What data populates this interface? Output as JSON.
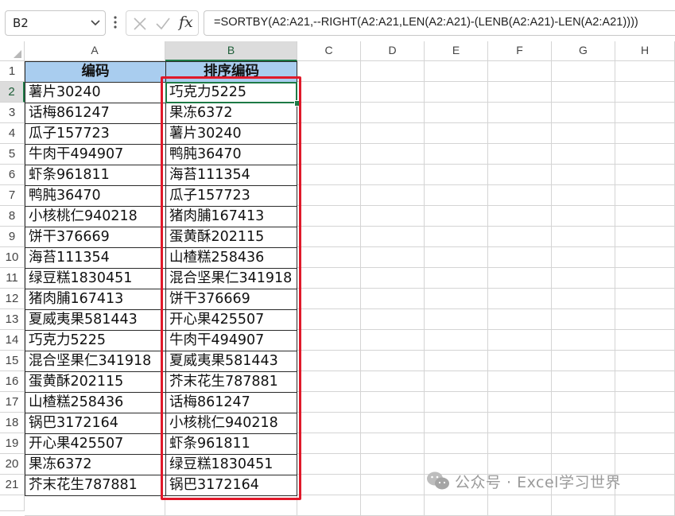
{
  "formula_bar": {
    "name_box": "B2",
    "fx_label": "fx",
    "formula": "=SORTBY(A2:A21,--RIGHT(A2:A21,LEN(A2:A21)-(LENB(A2:A21)-LEN(A2:A21))))"
  },
  "sheet": {
    "columns": [
      "A",
      "B",
      "C",
      "D",
      "E",
      "F",
      "G",
      "H"
    ],
    "rows": [
      "1",
      "2",
      "3",
      "4",
      "5",
      "6",
      "7",
      "8",
      "9",
      "10",
      "11",
      "12",
      "13",
      "14",
      "15",
      "16",
      "17",
      "18",
      "19",
      "20",
      "21"
    ],
    "col_a_header": "编码",
    "col_b_header": "排序编码",
    "col_a": [
      "薯片30240",
      "话梅861247",
      "瓜子157723",
      "牛肉干494907",
      "虾条961811",
      "鸭肫36470",
      "小核桃仁940218",
      "饼干376669",
      "海苔111354",
      "绿豆糕1830451",
      "猪肉脯167413",
      "夏威夷果581443",
      "巧克力5225",
      "混合坚果仁341918",
      "蛋黄酥202115",
      "山楂糕258436",
      "锅巴3172164",
      "开心果425507",
      "果冻6372",
      "芥末花生787881"
    ],
    "col_b": [
      "巧克力5225",
      "果冻6372",
      "薯片30240",
      "鸭肫36470",
      "海苔111354",
      "瓜子157723",
      "猪肉脯167413",
      "蛋黄酥202115",
      "山楂糕258436",
      "混合坚果仁341918",
      "饼干376669",
      "开心果425507",
      "牛肉干494907",
      "夏威夷果581443",
      "芥末花生787881",
      "话梅861247",
      "小核桃仁940218",
      "虾条961811",
      "绿豆糕1830451",
      "锅巴3172164"
    ],
    "header_fill": "#a9cdef",
    "highlight_color": "#e0192a",
    "selection_color": "#1e7a46"
  },
  "watermark": {
    "text": "公众号 · Excel学习世界",
    "icon": "wechat-icon"
  }
}
